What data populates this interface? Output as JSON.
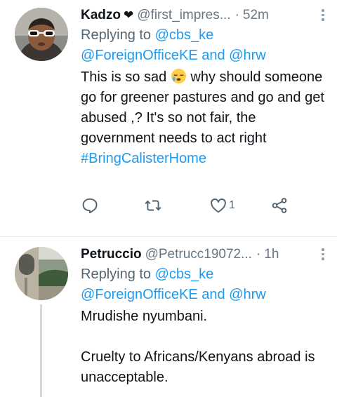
{
  "tweets": [
    {
      "name": "Kadzo",
      "badge": "black-heart-icon",
      "handle": "@first_impres...",
      "separator": "·",
      "time": "52m",
      "replying_prefix": "Replying to",
      "mention_1": "@cbs_ke",
      "mention_2": "@ForeignOfficeKE",
      "and": "and",
      "mention_3": "@hrw",
      "text_part1": "This is so sad",
      "emoji": "sleepy-face-emoji",
      "text_part2": " why should someone go for greener pastures and go and get abused ,? It's so not fair, the government needs to act right",
      "hashtag": "#BringCalisterHome",
      "actions": {
        "reply_count": "",
        "retweet_count": "",
        "like_count": "1",
        "share_count": ""
      }
    },
    {
      "name": "Petruccio",
      "handle": "@Petrucc19072...",
      "separator": "·",
      "time": "1h",
      "replying_prefix": "Replying to",
      "mention_1": "@cbs_ke",
      "mention_2": "@ForeignOfficeKE",
      "and": "and",
      "mention_3": "@hrw",
      "text_line1": "Mrudishe nyumbani.",
      "text_line2": "Cruelty to Africans/Kenyans abroad is unacceptable."
    }
  ],
  "colors": {
    "accent": "#1d9bf0",
    "secondary_text": "#687684",
    "divider": "#e1e8ed"
  }
}
